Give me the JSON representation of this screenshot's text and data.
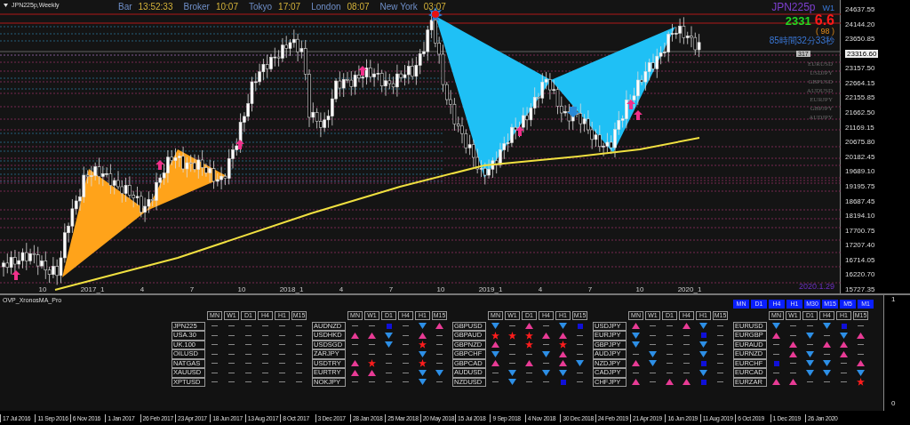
{
  "chart": {
    "title": "JPN225p,Weekly",
    "clocks": [
      {
        "label": "Bar",
        "value": "13:52:33"
      },
      {
        "label": "Broker",
        "value": "10:07"
      },
      {
        "label": "Tokyo",
        "value": "17:07"
      },
      {
        "label": "London",
        "value": "08:07"
      },
      {
        "label": "New York",
        "value": "03:07"
      }
    ],
    "info": {
      "symbol": "JPN225p",
      "timeframe": "W1",
      "price_head": "2331",
      "price_tail": "6.6",
      "spread": "( 98 )",
      "countdown": "85時間32分33秒"
    },
    "spread_tag": "317",
    "watchlist": [
      "EURUSD",
      "USDJPY",
      "GBPUSD",
      "AUDUSD",
      "EURJPY",
      "GBPJPY",
      "AUDJPY"
    ],
    "date_label": "2020.1.29",
    "period_labels": [
      "10",
      "2017_1",
      "4",
      "7",
      "10",
      "2018_1",
      "4",
      "7",
      "10",
      "2019_1",
      "4",
      "7",
      "10",
      "2020_1"
    ],
    "price_axis": [
      "24637.55",
      "24144.20",
      "23650.85",
      "23157.50",
      "22664.15",
      "22155.85",
      "21662.50",
      "21169.15",
      "20675.80",
      "20182.45",
      "19689.10",
      "19195.75",
      "18687.45",
      "18194.10",
      "17700.75",
      "17207.40",
      "16714.05",
      "16220.70",
      "15727.35"
    ],
    "current_price": "23316.60"
  },
  "indicator": {
    "title": "OVP_XronosMA_Pro",
    "axis": [
      "1",
      "0"
    ],
    "groups": [
      {
        "columns": [
          "MN",
          "W1",
          "D1",
          "H4",
          "H1",
          "M15"
        ],
        "rows": [
          {
            "symbol": "JPN225",
            "signals": [
              {
                "kind": "none"
              },
              {
                "kind": "none"
              },
              {
                "kind": "none"
              },
              {
                "kind": "none"
              },
              {
                "kind": "none"
              },
              {
                "kind": "none"
              }
            ]
          },
          {
            "symbol": "USA.30",
            "signals": [
              {
                "kind": "none"
              },
              {
                "kind": "none"
              },
              {
                "kind": "none"
              },
              {
                "kind": "none"
              },
              {
                "kind": "none"
              },
              {
                "kind": "none"
              }
            ]
          },
          {
            "symbol": "UK.100",
            "signals": [
              {
                "kind": "none"
              },
              {
                "kind": "none"
              },
              {
                "kind": "none"
              },
              {
                "kind": "none"
              },
              {
                "kind": "none"
              },
              {
                "kind": "none"
              }
            ]
          },
          {
            "symbol": "OILUSD",
            "signals": [
              {
                "kind": "none"
              },
              {
                "kind": "none"
              },
              {
                "kind": "none"
              },
              {
                "kind": "none"
              },
              {
                "kind": "none"
              },
              {
                "kind": "none"
              }
            ]
          },
          {
            "symbol": "NATGAS",
            "signals": [
              {
                "kind": "none"
              },
              {
                "kind": "none"
              },
              {
                "kind": "none"
              },
              {
                "kind": "none"
              },
              {
                "kind": "none"
              },
              {
                "kind": "none"
              }
            ]
          },
          {
            "symbol": "XAUUSD",
            "signals": [
              {
                "kind": "none"
              },
              {
                "kind": "none"
              },
              {
                "kind": "none"
              },
              {
                "kind": "none"
              },
              {
                "kind": "none"
              },
              {
                "kind": "none"
              }
            ]
          },
          {
            "symbol": "XPTUSD",
            "signals": [
              {
                "kind": "none"
              },
              {
                "kind": "none"
              },
              {
                "kind": "none"
              },
              {
                "kind": "none"
              },
              {
                "kind": "none"
              },
              {
                "kind": "none"
              }
            ]
          }
        ]
      },
      {
        "columns": [
          "MN",
          "W1",
          "D1",
          "H4",
          "H1",
          "M15"
        ],
        "rows": [
          {
            "symbol": "AUDNZD",
            "signals": [
              {
                "kind": "none"
              },
              {
                "kind": "none"
              },
              {
                "kind": "square"
              },
              {
                "kind": "none"
              },
              {
                "kind": "down"
              },
              {
                "kind": "up"
              }
            ]
          },
          {
            "symbol": "USDHKD",
            "signals": [
              {
                "kind": "up"
              },
              {
                "kind": "up"
              },
              {
                "kind": "down"
              },
              {
                "kind": "none"
              },
              {
                "kind": "up"
              },
              {
                "kind": "none"
              }
            ]
          },
          {
            "symbol": "USDSGD",
            "signals": [
              {
                "kind": "none"
              },
              {
                "kind": "none"
              },
              {
                "kind": "down"
              },
              {
                "kind": "none"
              },
              {
                "kind": "star"
              },
              {
                "kind": "none"
              }
            ]
          },
          {
            "symbol": "ZARJPY",
            "signals": [
              {
                "kind": "none"
              },
              {
                "kind": "none"
              },
              {
                "kind": "none"
              },
              {
                "kind": "none"
              },
              {
                "kind": "down"
              },
              {
                "kind": "none"
              }
            ]
          },
          {
            "symbol": "USDTRY",
            "signals": [
              {
                "kind": "up"
              },
              {
                "kind": "star"
              },
              {
                "kind": "none"
              },
              {
                "kind": "none"
              },
              {
                "kind": "star"
              },
              {
                "kind": "none"
              }
            ]
          },
          {
            "symbol": "EURTRY",
            "signals": [
              {
                "kind": "up"
              },
              {
                "kind": "up"
              },
              {
                "kind": "none"
              },
              {
                "kind": "none"
              },
              {
                "kind": "down"
              },
              {
                "kind": "down"
              }
            ]
          },
          {
            "symbol": "NOKJPY",
            "signals": [
              {
                "kind": "none"
              },
              {
                "kind": "none"
              },
              {
                "kind": "none"
              },
              {
                "kind": "none"
              },
              {
                "kind": "down"
              },
              {
                "kind": "none"
              }
            ]
          }
        ]
      },
      {
        "columns": [
          "MN",
          "W1",
          "D1",
          "H4",
          "H1",
          "M15"
        ],
        "rows": [
          {
            "symbol": "GBPUSD",
            "signals": [
              {
                "kind": "down"
              },
              {
                "kind": "none"
              },
              {
                "kind": "up"
              },
              {
                "kind": "none"
              },
              {
                "kind": "down"
              },
              {
                "kind": "square"
              }
            ]
          },
          {
            "symbol": "GBPAUD",
            "signals": [
              {
                "kind": "star"
              },
              {
                "kind": "star"
              },
              {
                "kind": "star"
              },
              {
                "kind": "up"
              },
              {
                "kind": "up"
              },
              {
                "kind": "none"
              }
            ]
          },
          {
            "symbol": "GBPNZD",
            "signals": [
              {
                "kind": "up"
              },
              {
                "kind": "none"
              },
              {
                "kind": "star"
              },
              {
                "kind": "none"
              },
              {
                "kind": "star"
              },
              {
                "kind": "none"
              }
            ]
          },
          {
            "symbol": "GBPCHF",
            "signals": [
              {
                "kind": "down"
              },
              {
                "kind": "none"
              },
              {
                "kind": "none"
              },
              {
                "kind": "down"
              },
              {
                "kind": "up"
              },
              {
                "kind": "none"
              }
            ]
          },
          {
            "symbol": "GBPCAD",
            "signals": [
              {
                "kind": "up"
              },
              {
                "kind": "none"
              },
              {
                "kind": "up"
              },
              {
                "kind": "none"
              },
              {
                "kind": "up"
              },
              {
                "kind": "down"
              }
            ]
          },
          {
            "symbol": "AUDUSD",
            "signals": [
              {
                "kind": "none"
              },
              {
                "kind": "down"
              },
              {
                "kind": "none"
              },
              {
                "kind": "down"
              },
              {
                "kind": "down"
              },
              {
                "kind": "none"
              }
            ]
          },
          {
            "symbol": "NZDUSD",
            "signals": [
              {
                "kind": "none"
              },
              {
                "kind": "down"
              },
              {
                "kind": "none"
              },
              {
                "kind": "none"
              },
              {
                "kind": "square"
              },
              {
                "kind": "none"
              }
            ]
          }
        ]
      },
      {
        "columns": [
          "MN",
          "W1",
          "D1",
          "H4",
          "H1",
          "M15"
        ],
        "rows": [
          {
            "symbol": "USDJPY",
            "signals": [
              {
                "kind": "up"
              },
              {
                "kind": "none"
              },
              {
                "kind": "none"
              },
              {
                "kind": "up"
              },
              {
                "kind": "down"
              },
              {
                "kind": "none"
              }
            ]
          },
          {
            "symbol": "EURJPY",
            "signals": [
              {
                "kind": "down"
              },
              {
                "kind": "none"
              },
              {
                "kind": "none"
              },
              {
                "kind": "none"
              },
              {
                "kind": "square"
              },
              {
                "kind": "none"
              }
            ]
          },
          {
            "symbol": "GBPJPY",
            "signals": [
              {
                "kind": "down"
              },
              {
                "kind": "none"
              },
              {
                "kind": "none"
              },
              {
                "kind": "none"
              },
              {
                "kind": "down"
              },
              {
                "kind": "none"
              }
            ]
          },
          {
            "symbol": "AUDJPY",
            "signals": [
              {
                "kind": "none"
              },
              {
                "kind": "down"
              },
              {
                "kind": "none"
              },
              {
                "kind": "none"
              },
              {
                "kind": "down"
              },
              {
                "kind": "none"
              }
            ]
          },
          {
            "symbol": "NZDJPY",
            "signals": [
              {
                "kind": "up"
              },
              {
                "kind": "down"
              },
              {
                "kind": "none"
              },
              {
                "kind": "none"
              },
              {
                "kind": "square"
              },
              {
                "kind": "none"
              }
            ]
          },
          {
            "symbol": "CADJPY",
            "signals": [
              {
                "kind": "none"
              },
              {
                "kind": "none"
              },
              {
                "kind": "none"
              },
              {
                "kind": "none"
              },
              {
                "kind": "down"
              },
              {
                "kind": "none"
              }
            ]
          },
          {
            "symbol": "CHFJPY",
            "signals": [
              {
                "kind": "up"
              },
              {
                "kind": "none"
              },
              {
                "kind": "up"
              },
              {
                "kind": "up"
              },
              {
                "kind": "square"
              },
              {
                "kind": "none"
              }
            ]
          }
        ]
      },
      {
        "timeframe_buttons": [
          "MN",
          "D1",
          "H4",
          "H1",
          "M30",
          "M15",
          "M5",
          "M1"
        ],
        "columns": [
          "MN",
          "W1",
          "D1",
          "H4",
          "H1",
          "M15"
        ],
        "rows": [
          {
            "symbol": "EURUSD",
            "signals": [
              {
                "kind": "down"
              },
              {
                "kind": "none"
              },
              {
                "kind": "none"
              },
              {
                "kind": "down"
              },
              {
                "kind": "square"
              },
              {
                "kind": "none"
              }
            ]
          },
          {
            "symbol": "EURGBP",
            "signals": [
              {
                "kind": "up"
              },
              {
                "kind": "none"
              },
              {
                "kind": "down"
              },
              {
                "kind": "none"
              },
              {
                "kind": "down"
              },
              {
                "kind": "up"
              }
            ]
          },
          {
            "symbol": "EURAUD",
            "signals": [
              {
                "kind": "none"
              },
              {
                "kind": "up"
              },
              {
                "kind": "none"
              },
              {
                "kind": "up"
              },
              {
                "kind": "up"
              },
              {
                "kind": "none"
              }
            ]
          },
          {
            "symbol": "EURNZD",
            "signals": [
              {
                "kind": "none"
              },
              {
                "kind": "up"
              },
              {
                "kind": "down"
              },
              {
                "kind": "none"
              },
              {
                "kind": "up"
              },
              {
                "kind": "none"
              }
            ]
          },
          {
            "symbol": "EURCHF",
            "signals": [
              {
                "kind": "square"
              },
              {
                "kind": "none"
              },
              {
                "kind": "down"
              },
              {
                "kind": "down"
              },
              {
                "kind": "none"
              },
              {
                "kind": "up"
              }
            ]
          },
          {
            "symbol": "EURCAD",
            "signals": [
              {
                "kind": "none"
              },
              {
                "kind": "none"
              },
              {
                "kind": "down"
              },
              {
                "kind": "down"
              },
              {
                "kind": "none"
              },
              {
                "kind": "down"
              }
            ]
          },
          {
            "symbol": "EURZAR",
            "signals": [
              {
                "kind": "up"
              },
              {
                "kind": "up"
              },
              {
                "kind": "none"
              },
              {
                "kind": "none"
              },
              {
                "kind": "none"
              },
              {
                "kind": "star"
              }
            ]
          }
        ]
      }
    ]
  },
  "date_axis": [
    "17 Jul 2016",
    "11 Sep 2016",
    "6 Nov 2016",
    "1 Jan 2017",
    "26 Feb 2017",
    "23 Apr 2017",
    "18 Jun 2017",
    "13 Aug 2017",
    "8 Oct 2017",
    "3 Dec 2017",
    "28 Jan 2018",
    "25 Mar 2018",
    "20 May 2018",
    "15 Jul 2018",
    "9 Sep 2018",
    "4 Nov 2018",
    "30 Dec 2018",
    "24 Feb 2019",
    "21 Apr 2019",
    "16 Jun 2019",
    "11 Aug 2019",
    "6 Oct 2019",
    "1 Dec 2019",
    "26 Jan 2020"
  ]
}
